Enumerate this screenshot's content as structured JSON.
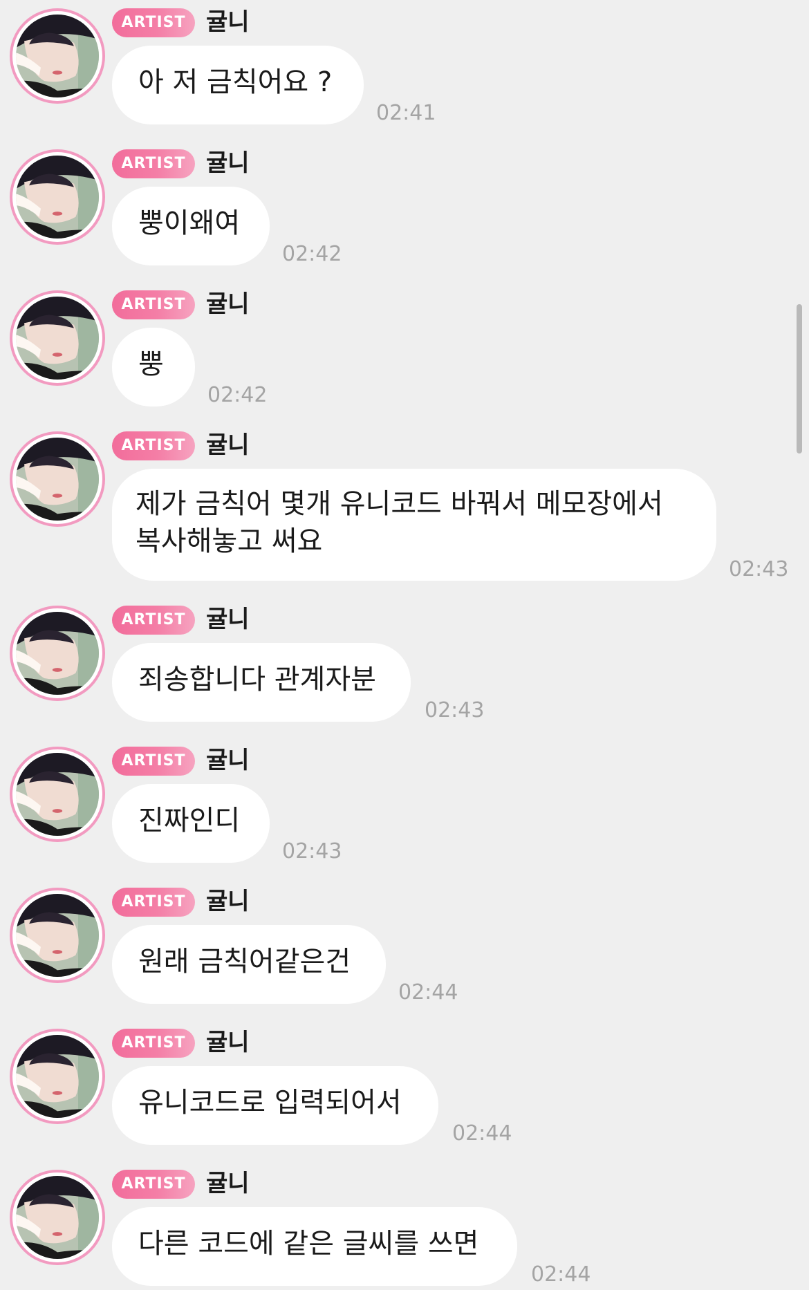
{
  "badge_label": "ARTIST",
  "sender_name": "귤니",
  "messages": [
    {
      "text": "아 저 금칙어요 ?",
      "time": "02:41"
    },
    {
      "text": "뿡이왜여",
      "time": "02:42"
    },
    {
      "text": "뿡",
      "time": "02:42"
    },
    {
      "text": "제가 금칙어 몇개 유니코드 바꿔서 메모장에서\n복사해놓고 써요",
      "time": "02:43"
    },
    {
      "text": "죄송합니다 관계자분",
      "time": "02:43"
    },
    {
      "text": "진짜인디",
      "time": "02:43"
    },
    {
      "text": "원래 금칙어같은건",
      "time": "02:44"
    },
    {
      "text": "유니코드로 입력되어서",
      "time": "02:44"
    },
    {
      "text": "다른 코드에 같은 글씨를 쓰면",
      "time": "02:44"
    }
  ],
  "colors": {
    "background": "#efefef",
    "bubble": "#ffffff",
    "badge_pink": "#f26d9b",
    "avatar_ring": "#f29ac0",
    "timestamp": "#a4a4a4"
  }
}
